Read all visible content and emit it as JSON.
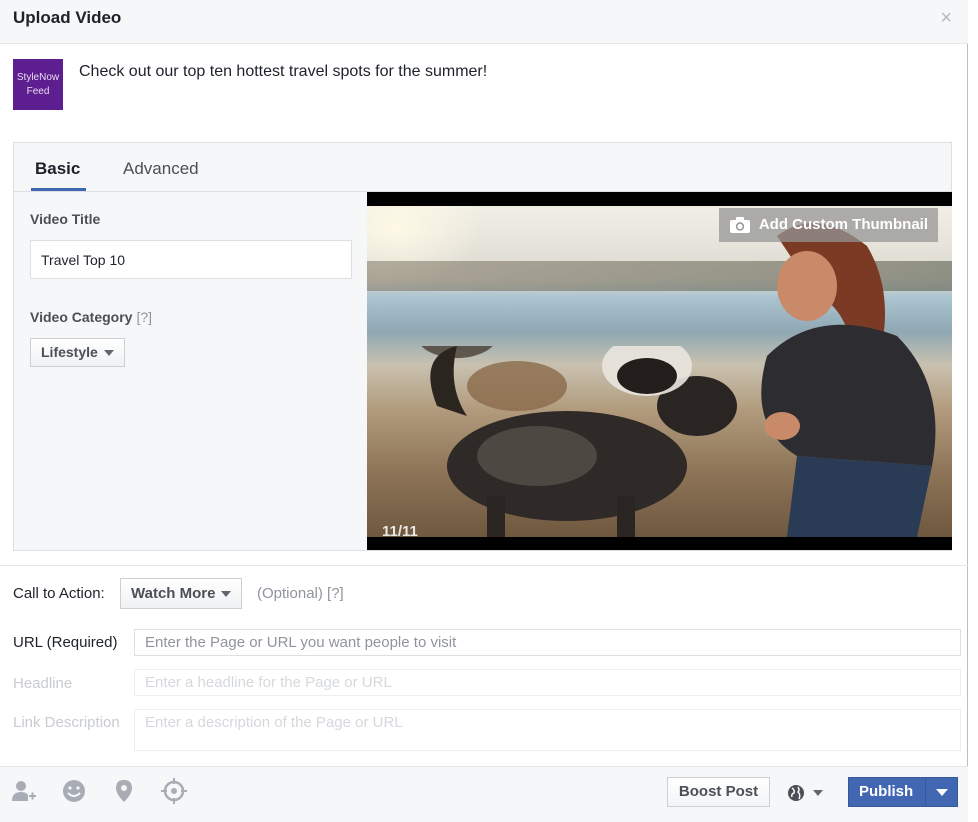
{
  "dialog": {
    "title": "Upload Video",
    "close_glyph": "×"
  },
  "composer": {
    "page_avatar_line1": "StyleNow",
    "page_avatar_line2": "Feed",
    "status_text": "Check out our top ten hottest travel spots for the summer!"
  },
  "tabs": [
    {
      "label": "Basic",
      "active": true
    },
    {
      "label": "Advanced",
      "active": false
    }
  ],
  "basic": {
    "video_title_label": "Video Title",
    "video_title_value": "Travel Top 10",
    "video_category_label": "Video Category",
    "help_marker": "[?]",
    "video_category_value": "Lifestyle"
  },
  "video": {
    "add_thumbnail_label": "Add Custom Thumbnail",
    "frame_counter": "11/11"
  },
  "cta": {
    "label": "Call to Action:",
    "selected": "Watch More",
    "optional_text": "(Optional)",
    "help_marker": "[?]"
  },
  "fields": {
    "url_label": "URL (Required)",
    "url_placeholder": "Enter the Page or URL you want people to visit",
    "headline_label": "Headline",
    "headline_placeholder": "Enter a headline for the Page or URL",
    "description_label": "Link Description",
    "description_placeholder": "Enter a description of the Page or URL"
  },
  "footer": {
    "icons": [
      "tag-people-icon",
      "feeling-icon",
      "location-pin-icon",
      "target-icon"
    ],
    "boost_label": "Boost Post",
    "privacy_icon": "globe-icon",
    "publish_label": "Publish"
  },
  "colors": {
    "brand_blue": "#4267b2",
    "avatar_purple": "#5d1f8f",
    "header_bg": "#f6f7f9"
  }
}
